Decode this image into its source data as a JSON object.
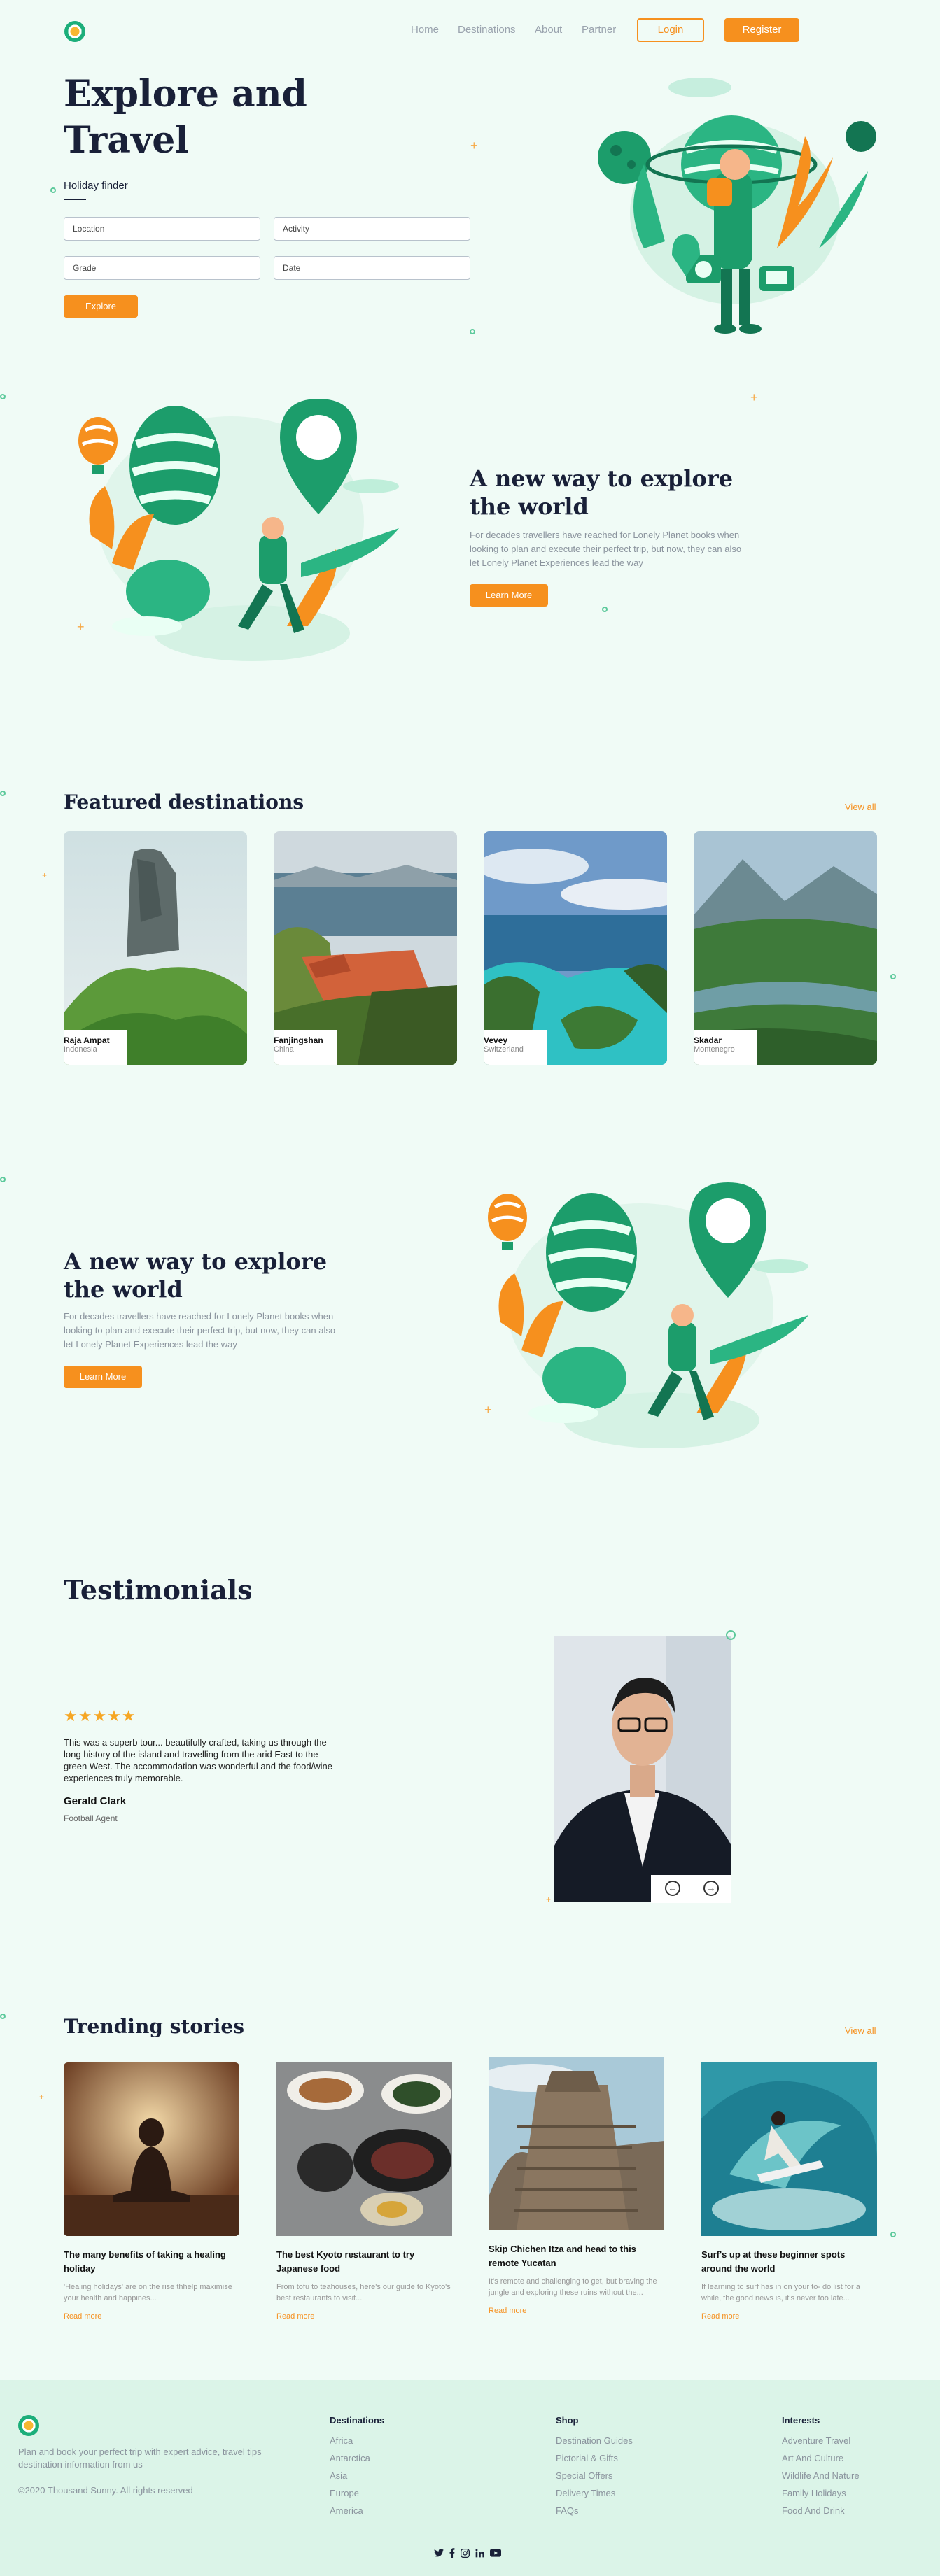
{
  "nav": {
    "links": [
      "Home",
      "Destinations",
      "About",
      "Partner"
    ],
    "login": "Login",
    "register": "Register"
  },
  "hero": {
    "title_line1": "Explore and",
    "title_line2": "Travel",
    "finder_label": "Holiday finder",
    "fields": {
      "location": "Location",
      "activity": "Activity",
      "grade": "Grade",
      "date": "Date"
    },
    "explore_button": "Explore"
  },
  "feature1": {
    "title": "A new way to explore the world",
    "text": "For decades travellers have reached for Lonely Planet books when looking to plan and execute their perfect trip, but now, they can also let Lonely Planet Experiences lead the way",
    "button": "Learn More"
  },
  "featured": {
    "title": "Featured destinations",
    "view_all": "View all",
    "cards": [
      {
        "name": "Raja Ampat",
        "country": "Indonesia"
      },
      {
        "name": "Fanjingshan",
        "country": "China"
      },
      {
        "name": "Vevey",
        "country": "Switzerland"
      },
      {
        "name": "Skadar",
        "country": "Montenegro"
      }
    ]
  },
  "feature2": {
    "title": "A new way to explore the world",
    "text": "For decades travellers have reached for Lonely Planet books when looking to plan and execute their perfect trip, but now, they can also let Lonely Planet Experiences lead the way",
    "button": "Learn More"
  },
  "testimonials": {
    "title": "Testimonials",
    "stars": "★★★★★",
    "quote": "This was a superb tour... beautifully crafted, taking us through the long history of the island and travelling from the arid East to the green West. The accommodation was wonderful and the food/wine experiences truly memorable.",
    "name": "Gerald Clark",
    "role": "Football Agent"
  },
  "trending": {
    "title": "Trending stories",
    "view_all": "View all",
    "stories": [
      {
        "title": "The many benefits of taking a healing holiday",
        "excerpt": "'Healing holidays' are on the rise thhelp maximise your health and happines...",
        "read_more": "Read more"
      },
      {
        "title": "The best Kyoto restaurant to try Japanese food",
        "excerpt": "From tofu to teahouses, here's our guide to Kyoto's best restaurants to visit...",
        "read_more": "Read more"
      },
      {
        "title": "Skip Chichen Itza and head to this remote Yucatan",
        "excerpt": "It's remote and challenging to get, but braving the jungle and exploring these ruins without the...",
        "read_more": "Read more"
      },
      {
        "title": "Surf's up at these beginner spots around the world",
        "excerpt": "If learning to surf has in on your to- do list for a while, the good news is, it's never too late...",
        "read_more": "Read more"
      }
    ]
  },
  "footer": {
    "tagline": "Plan and book your perfect trip with expert advice, travel tips destination information from us",
    "copyright": "©2020 Thousand Sunny. All rights reserved",
    "columns": [
      {
        "heading": "Destinations",
        "items": [
          "Africa",
          "Antarctica",
          "Asia",
          "Europe",
          "America"
        ]
      },
      {
        "heading": "Shop",
        "items": [
          "Destination Guides",
          "Pictorial & Gifts",
          "Special Offers",
          "Delivery Times",
          "FAQs"
        ]
      },
      {
        "heading": "Interests",
        "items": [
          "Adventure Travel",
          "Art And Culture",
          "Wildlife And Nature",
          "Family Holidays",
          "Food And Drink"
        ]
      }
    ]
  },
  "colors": {
    "accent": "#f6901e",
    "brand_green": "#1cae7a",
    "background": "#f0fbf6",
    "footer_bg": "#dbf4e8"
  }
}
